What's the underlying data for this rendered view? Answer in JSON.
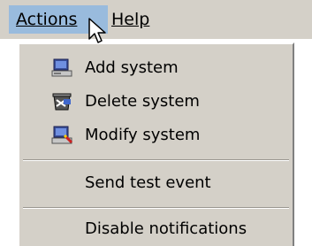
{
  "menubar": {
    "actions_label": "Actions",
    "help_label": "Help"
  },
  "menu": {
    "items": [
      {
        "label": "Add system",
        "icon": "computer-icon"
      },
      {
        "label": "Delete system",
        "icon": "delete-system-icon"
      },
      {
        "label": "Modify system",
        "icon": "modify-system-icon"
      },
      {
        "label": "Send test event"
      },
      {
        "label": "Disable notifications"
      }
    ]
  },
  "colors": {
    "menu_background": "#d4d0c8",
    "highlight": "#99bbdd"
  }
}
